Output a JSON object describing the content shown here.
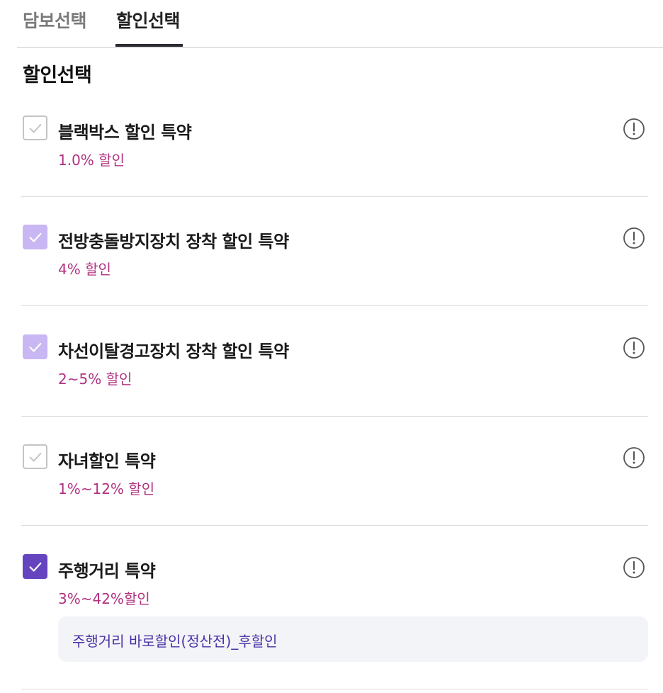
{
  "tabs": [
    {
      "label": "담보선택",
      "active": false
    },
    {
      "label": "할인선택",
      "active": true
    }
  ],
  "section_title": "할인선택",
  "items": [
    {
      "label": "블랙박스 할인 특약",
      "rate": "1.0% 할인",
      "state": "disabled-check"
    },
    {
      "label": "전방충돌방지장치 장착 할인 특약",
      "rate": "4% 할인",
      "state": "light-check"
    },
    {
      "label": "차선이탈경고장치 장착 할인 특약",
      "rate": "2~5% 할인",
      "state": "light-check"
    },
    {
      "label": "자녀할인 특약",
      "rate": "1%~12% 할인",
      "state": "disabled-check"
    },
    {
      "label": "주행거리 특약",
      "rate": "3%~42%할인",
      "state": "dark-check"
    }
  ],
  "sub_option": "주행거리 바로할인(정산전)_후할인",
  "colors": {
    "accent_dark": "#6544c0",
    "accent_light": "#c8b7f3",
    "rate_text": "#b0327f",
    "sub_text": "#4a2fa5"
  },
  "icons": {
    "check": "check-icon",
    "info": "exclamation-circle-icon"
  }
}
